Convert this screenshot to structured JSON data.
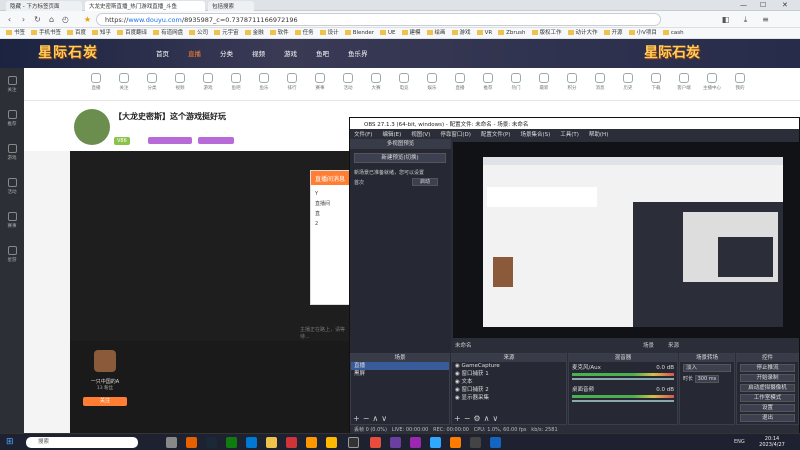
{
  "browser": {
    "tabs": [
      {
        "label": "隐藏 - 下方标签页面"
      },
      {
        "label": "大龙史密斯直播_热门游戏直播_斗鱼"
      },
      {
        "label": "包括搜索"
      }
    ],
    "url": {
      "scheme": "https://",
      "host": "www.douyu.com",
      "path": "/8935987_c=0.7378711166972196"
    },
    "window_buttons": {
      "min": "—",
      "max": "☐",
      "close": "✕"
    },
    "bookmarks": [
      "书签",
      "手机书签",
      "百度",
      "知乎",
      "百度翻译",
      "有道网盘",
      "公司",
      "元宇宙",
      "金融",
      "软件",
      "任务",
      "设计",
      "Blender",
      "UE",
      "建模",
      "绘画",
      "游戏",
      "VR",
      "Zbrush",
      "版权工作",
      "动计大作",
      "开源",
      "小V项目",
      "cash"
    ]
  },
  "douyu": {
    "logo": "星际石炭",
    "nav": [
      "首页",
      "直播",
      "分类",
      "视频",
      "游戏",
      "鱼吧",
      "鱼乐界"
    ],
    "active_nav": "直播",
    "subnav": [
      "直播",
      "关注",
      "分类",
      "视频",
      "游戏",
      "鱼吧",
      "鱼乐",
      "排行",
      "赛事",
      "活动",
      "大赛",
      "电竞",
      "娱乐",
      "直播",
      "推荐",
      "热门",
      "最新",
      "积分",
      "消息",
      "历史",
      "下载",
      "客户端",
      "主播中心",
      "我的"
    ],
    "left_rail": [
      "关注",
      "推荐",
      "游戏",
      "活动",
      "赛事",
      "星游"
    ],
    "room": {
      "title": "【大龙史密斯】这个游戏挺好玩",
      "tag": "V86"
    },
    "popup": {
      "title": "直播间消息",
      "l1": "Y",
      "l2": "直播间",
      "l3": "直",
      "l4": "2"
    },
    "anchor": {
      "name": "一只中国的A",
      "fans": "13 粉丝",
      "follow": "关注"
    },
    "video_text": "主播正在路上，请等待..."
  },
  "obs": {
    "title": "OBS 27.1.3 (64-bit, windows) - 配置文件: 未命名 - 场景: 未命名",
    "menu": [
      "文件(F)",
      "编辑(E)",
      "视图(V)",
      "停靠窗口(D)",
      "配置文件(P)",
      "场景集合(S)",
      "工具(T)",
      "帮助(H)"
    ],
    "multiview": {
      "title": "多视图预览",
      "button": "新建预览(切换)",
      "desc1": "新场景已准备就绪，您可以设置",
      "desc2": "首次",
      "label": "启动"
    },
    "scene_bar": {
      "name": "未命名",
      "left": "场景",
      "right": "来源"
    },
    "docks": {
      "scenes": {
        "title": "场景",
        "items": [
          "直播",
          "黑屏"
        ]
      },
      "sources": {
        "title": "来源",
        "items": [
          "GameCapture",
          "窗口捕获 1",
          "文本",
          "窗口捕获 2",
          "显示器采集"
        ]
      },
      "mixer": {
        "title": "混音器",
        "tracks": [
          {
            "name": "麦克风/Aux",
            "db": "0.0 dB"
          },
          {
            "name": "桌面音频",
            "db": "0.0 dB"
          }
        ]
      },
      "transitions": {
        "title": "场景转场",
        "type": "淡入",
        "duration_label": "时长",
        "duration": "300 ms"
      },
      "controls": {
        "title": "控件",
        "buttons": [
          "停止推流",
          "开始录制",
          "启动虚拟摄像机",
          "工作室模式",
          "设置",
          "退出"
        ]
      }
    },
    "status": {
      "dropped": "丢帧 0 (0.0%)",
      "live": "LIVE: 00:00:00",
      "rec": "REC: 00:00:00",
      "cpu": "CPU: 1.0%, 60.00 fps",
      "kbps": "kb/s: 2581"
    }
  },
  "taskbar": {
    "search": "搜索",
    "time": "20:14",
    "date": "2023/4/27",
    "lang": "ENG"
  },
  "colors": {
    "accent": "#ff7e33",
    "obs_bg": "#2b2e38",
    "taskbar": "#1e2230"
  }
}
